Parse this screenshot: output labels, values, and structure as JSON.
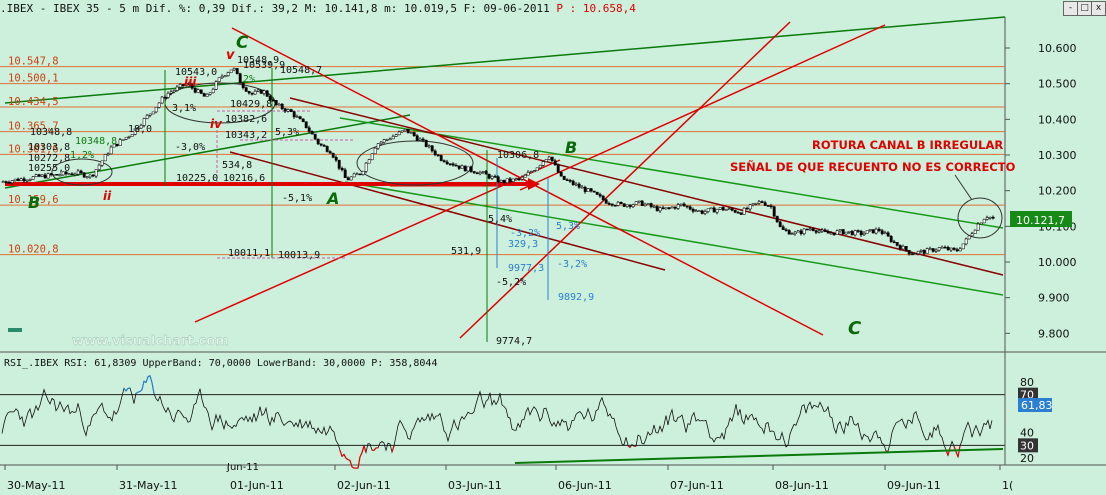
{
  "header": {
    "symbol": ".IBEX - IBEX 35 -",
    "timeframe": "5 m",
    "dif_label": "Dif. %: 0,39",
    "dif": "Dif.: 39,2",
    "max": "M: 10.141,8",
    "min": "m: 10.019,5",
    "date": "F: 09-06-2011",
    "price": "P : 10.658,4"
  },
  "window_buttons": [
    "-",
    "□",
    "x"
  ],
  "watermark": "www.visualchart.com",
  "colors": {
    "background": "#ccf0dc",
    "red": "#e00000",
    "green": "#0a8a0a",
    "darkred": "#8b0000",
    "blue": "#2a7fd0",
    "last_price_box": "#168a16"
  },
  "chart_data": [
    {
      "type": "candlestick",
      "title": "IBEX 35 - 5 m",
      "ylim": [
        9750,
        10700
      ],
      "y_ticks": [
        "10.600",
        "10.500",
        "10.400",
        "10.300",
        "10.200",
        "10.100",
        "10.000",
        "9.900",
        "9.800"
      ],
      "x_labels": [
        "30-May-11",
        "31-May-11",
        "01-Jun-11",
        "02-Jun-11",
        "03-Jun-11",
        "06-Jun-11",
        "07-Jun-11",
        "08-Jun-11",
        "09-Jun-11",
        "1("
      ],
      "last_price": "10.121,7",
      "close_path": [
        [
          0,
          10225
        ],
        [
          40,
          10240
        ],
        [
          75,
          10250
        ],
        [
          90,
          10240
        ],
        [
          110,
          10320
        ],
        [
          130,
          10360
        ],
        [
          150,
          10420
        ],
        [
          165,
          10470
        ],
        [
          185,
          10500
        ],
        [
          205,
          10460
        ],
        [
          220,
          10520
        ],
        [
          232,
          10545
        ],
        [
          240,
          10500
        ],
        [
          250,
          10470
        ],
        [
          262,
          10480
        ],
        [
          275,
          10440
        ],
        [
          290,
          10420
        ],
        [
          305,
          10380
        ],
        [
          318,
          10330
        ],
        [
          330,
          10310
        ],
        [
          345,
          10230
        ],
        [
          360,
          10250
        ],
        [
          375,
          10330
        ],
        [
          390,
          10350
        ],
        [
          405,
          10370
        ],
        [
          420,
          10340
        ],
        [
          440,
          10290
        ],
        [
          460,
          10265
        ],
        [
          480,
          10250
        ],
        [
          500,
          10225
        ],
        [
          520,
          10232
        ],
        [
          535,
          10265
        ],
        [
          548,
          10300
        ],
        [
          560,
          10235
        ],
        [
          575,
          10215
        ],
        [
          590,
          10195
        ],
        [
          605,
          10170
        ],
        [
          620,
          10160
        ],
        [
          640,
          10165
        ],
        [
          660,
          10145
        ],
        [
          680,
          10160
        ],
        [
          700,
          10140
        ],
        [
          720,
          10150
        ],
        [
          740,
          10140
        ],
        [
          760,
          10170
        ],
        [
          770,
          10155
        ],
        [
          780,
          10090
        ],
        [
          795,
          10080
        ],
        [
          810,
          10095
        ],
        [
          825,
          10080
        ],
        [
          840,
          10085
        ],
        [
          860,
          10080
        ],
        [
          878,
          10090
        ],
        [
          895,
          10050
        ],
        [
          910,
          10025
        ],
        [
          925,
          10030
        ],
        [
          940,
          10040
        ],
        [
          955,
          10030
        ],
        [
          965,
          10060
        ],
        [
          975,
          10100
        ],
        [
          985,
          10130
        ],
        [
          993,
          10121
        ]
      ],
      "price_levels": [
        {
          "label": "10.547,8",
          "value": 10547.8
        },
        {
          "label": "10.500,1",
          "value": 10500.1
        },
        {
          "label": "10.434,5",
          "value": 10434.5
        },
        {
          "label": "10.365,7",
          "value": 10365.7
        },
        {
          "label": "10.301,6",
          "value": 10301.6
        },
        {
          "label": "10.159,6",
          "value": 10159.6
        },
        {
          "label": "10.020,8",
          "value": 10020.8
        }
      ],
      "annotations": [
        {
          "text": "ROTURA CANAL B IRREGULAR",
          "color": "#e00000"
        },
        {
          "text": "SEÑAL DE QUE RECUENTO NO ES CORRECTO",
          "color": "#e00000"
        }
      ],
      "wave_labels": [
        {
          "text": "C",
          "color": "#0a6a0a"
        },
        {
          "text": "B",
          "color": "#0a6a0a"
        },
        {
          "text": "A",
          "color": "#0a6a0a"
        },
        {
          "text": "B",
          "color": "#0a6a0a"
        },
        {
          "text": "C",
          "color": "#0a6a0a"
        },
        {
          "text": "v",
          "color": "#e00000"
        },
        {
          "text": "iii",
          "color": "#e00000"
        },
        {
          "text": "iv",
          "color": "#e00000"
        },
        {
          "text": "ii",
          "color": "#e00000"
        }
      ],
      "measure_labels": [
        "10548,9",
        "10548,7",
        "10543,0",
        "10539,9",
        "10429,8",
        "10382,6",
        "10343,2",
        "534,8",
        "10216,6",
        "10225,0",
        "10348,8",
        "10348,8",
        "10303,8",
        "10272,8",
        "10255,0",
        "10011,1",
        "10013,9",
        "531,9",
        "10306,8",
        "9977,3",
        "9892,9",
        "9774,7",
        "329,3",
        "-3,0%",
        "-5,1%",
        "-5,2%",
        "-3,2%",
        "5,3%",
        "-3,2%",
        "5,4%",
        "1,2%",
        "18,0",
        "3,1%",
        "2%",
        "5,3%"
      ]
    },
    {
      "type": "line",
      "title": "RSI_.IBEX RSI: 61,8309 UpperBand: 70,0000 LowerBand: 30,0000 P: 358,8044",
      "ylim": [
        15,
        85
      ],
      "y_ticks": [
        "80",
        "70",
        "40",
        "30",
        "20"
      ],
      "upper_band": 70,
      "lower_band": 30,
      "last_value": "61,83",
      "sub_label": "Jun-11"
    }
  ]
}
